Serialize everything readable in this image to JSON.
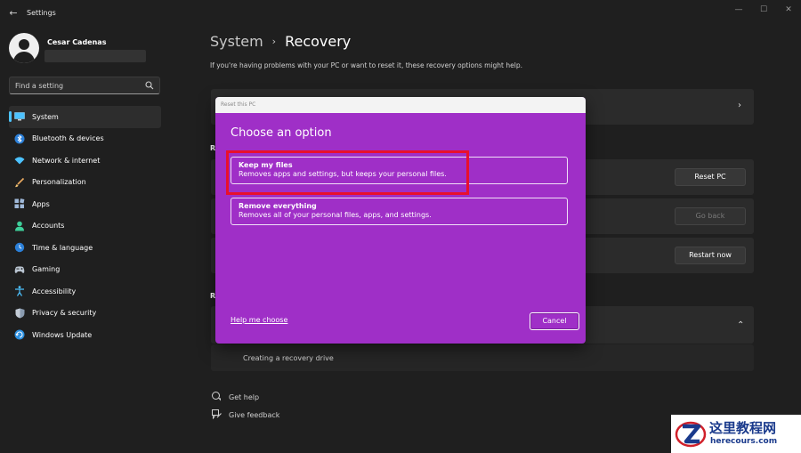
{
  "window": {
    "title": "Settings",
    "back_glyph": "←",
    "minimize_glyph": "—",
    "maximize_glyph": "☐",
    "close_glyph": "✕"
  },
  "user": {
    "name": "Cesar Cadenas"
  },
  "search": {
    "placeholder": "Find a setting"
  },
  "nav": [
    {
      "label": "System",
      "icon": "monitor-icon",
      "active": true
    },
    {
      "label": "Bluetooth & devices",
      "icon": "bluetooth-icon"
    },
    {
      "label": "Network & internet",
      "icon": "wifi-icon"
    },
    {
      "label": "Personalization",
      "icon": "brush-icon"
    },
    {
      "label": "Apps",
      "icon": "apps-icon"
    },
    {
      "label": "Accounts",
      "icon": "person-icon"
    },
    {
      "label": "Time & language",
      "icon": "globe-clock-icon"
    },
    {
      "label": "Gaming",
      "icon": "gamepad-icon"
    },
    {
      "label": "Accessibility",
      "icon": "accessibility-icon"
    },
    {
      "label": "Privacy & security",
      "icon": "shield-icon"
    },
    {
      "label": "Windows Update",
      "icon": "update-icon"
    }
  ],
  "main": {
    "breadcrumb_parent": "System",
    "breadcrumb_separator": "›",
    "breadcrumb_current": "Recovery",
    "intro": "If you're having problems with your PC or want to reset it, these recovery options might help.",
    "section_letter_1": "R",
    "section_letter_2": "R",
    "reset_button": "Reset PC",
    "goback_button": "Go back",
    "restart_button": "Restart now",
    "sub_item": "Creating a recovery drive",
    "chevron_right": "›",
    "chevron_up": "⌃",
    "get_help": "Get help",
    "give_feedback": "Give feedback"
  },
  "dialog": {
    "title": "Reset this PC",
    "heading": "Choose an option",
    "options": [
      {
        "title": "Keep my files",
        "desc": "Removes apps and settings, but keeps your personal files."
      },
      {
        "title": "Remove everything",
        "desc": "Removes all of your personal files, apps, and settings."
      }
    ],
    "help_link": "Help me choose",
    "cancel": "Cancel"
  },
  "watermark": {
    "cn": "这里教程网",
    "en": "herecours.com"
  },
  "colors": {
    "accent": "#4cc2ff",
    "dialog_bg": "#9f2fc7",
    "highlight": "#e8102c",
    "window_bg": "#1f1f1f"
  }
}
